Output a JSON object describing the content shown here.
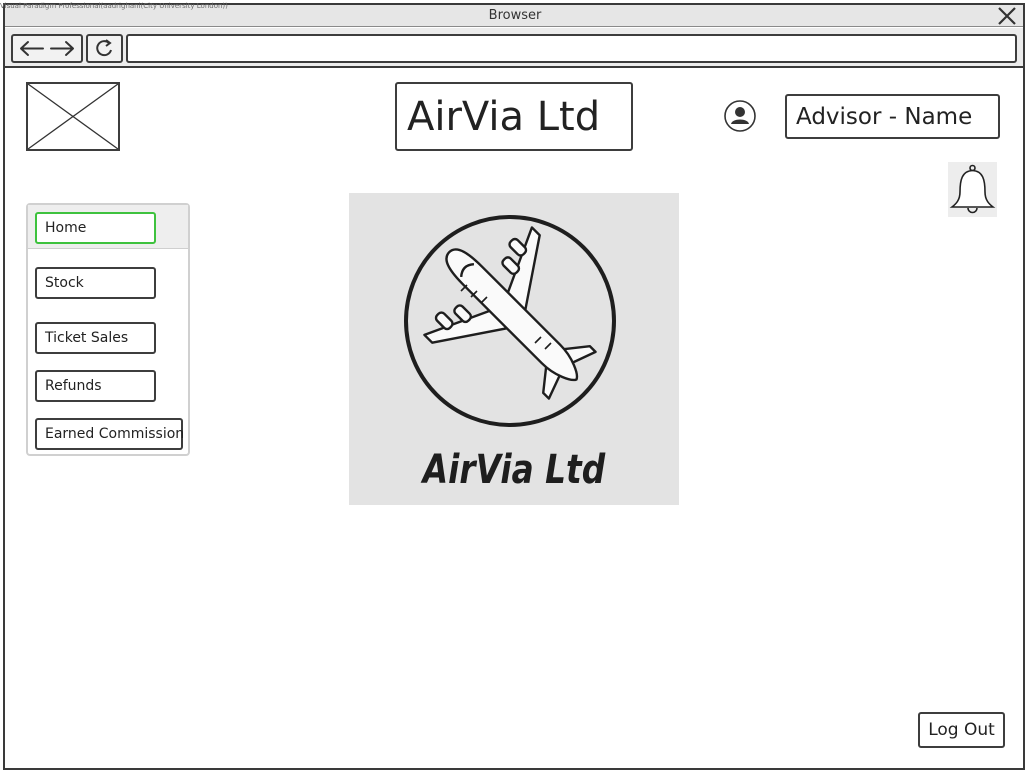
{
  "window": {
    "watermark": "Visual Paradigm Professional(aadrighani(City University London))",
    "title": "Browser"
  },
  "toolbar": {
    "url": ""
  },
  "header": {
    "app_title": "AirVia Ltd",
    "advisor_label": "Advisor - Name"
  },
  "sidebar": {
    "items": [
      {
        "label": "Home",
        "active": true
      },
      {
        "label": "Stock"
      },
      {
        "label": "Ticket Sales"
      },
      {
        "label": "Refunds"
      },
      {
        "label": "Earned Commission"
      }
    ]
  },
  "hero": {
    "brand_text": "AirVia Ltd"
  },
  "footer": {
    "logout_label": "Log Out"
  },
  "icons": [
    "close-icon",
    "back-arrow-icon",
    "forward-arrow-icon",
    "reload-icon",
    "user-icon",
    "bell-icon",
    "airplane-icon",
    "image-placeholder-icon"
  ],
  "colors": {
    "active_outline": "#3ec23e",
    "frame": "#3a3a3a",
    "hero_bg": "#e3e3e3"
  }
}
